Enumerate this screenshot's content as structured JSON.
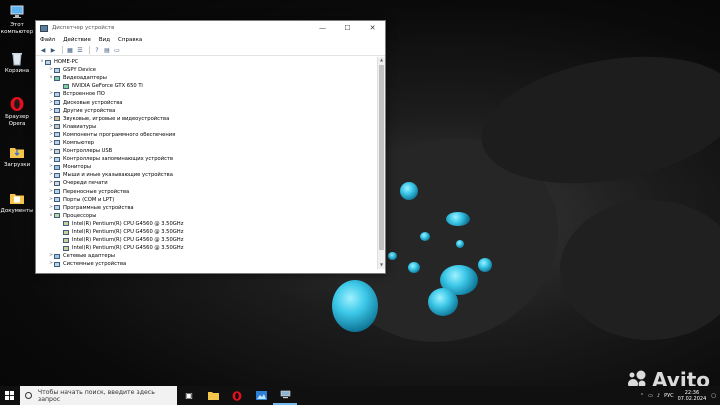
{
  "desktop": {
    "icons": [
      {
        "label": "Этот компьютер",
        "icon": "computer-icon"
      },
      {
        "label": "Корзина",
        "icon": "recycle-bin-icon"
      },
      {
        "label": "Браузер Opera",
        "icon": "opera-icon"
      },
      {
        "label": "Загрузки",
        "icon": "folder-icon"
      },
      {
        "label": "Документы",
        "icon": "folder-icon"
      }
    ]
  },
  "window": {
    "title": "Диспетчер устройств",
    "controls": {
      "minimize": "—",
      "maximize": "☐",
      "close": "✕"
    },
    "menu": [
      "Файл",
      "Действие",
      "Вид",
      "Справка"
    ],
    "toolbar": [
      "back-icon",
      "forward-icon",
      "grid-icon",
      "list-icon",
      "help-icon",
      "properties-icon",
      "monitor-icon"
    ],
    "tree": [
      {
        "depth": 0,
        "exp": "v",
        "label": "HOME-PC",
        "icon": "computer-icon"
      },
      {
        "depth": 1,
        "exp": ">",
        "label": "GSPY Device",
        "icon": "device-icon"
      },
      {
        "depth": 1,
        "exp": "v",
        "label": "Видеоадаптеры",
        "icon": "display-adapter-icon"
      },
      {
        "depth": 2,
        "exp": "",
        "label": "NVIDIA GeForce GTX 650 Ti",
        "icon": "display-adapter-icon"
      },
      {
        "depth": 1,
        "exp": ">",
        "label": "Встроенное ПО",
        "icon": "firmware-icon"
      },
      {
        "depth": 1,
        "exp": ">",
        "label": "Дисковые устройства",
        "icon": "disk-icon"
      },
      {
        "depth": 1,
        "exp": ">",
        "label": "Другие устройства",
        "icon": "other-devices-icon"
      },
      {
        "depth": 1,
        "exp": ">",
        "label": "Звуковые, игровые и видеоустройства",
        "icon": "sound-icon"
      },
      {
        "depth": 1,
        "exp": ">",
        "label": "Клавиатуры",
        "icon": "keyboard-icon"
      },
      {
        "depth": 1,
        "exp": ">",
        "label": "Компоненты программного обеспечения",
        "icon": "software-icon"
      },
      {
        "depth": 1,
        "exp": ">",
        "label": "Компьютер",
        "icon": "computer-icon"
      },
      {
        "depth": 1,
        "exp": ">",
        "label": "Контроллеры USB",
        "icon": "usb-icon"
      },
      {
        "depth": 1,
        "exp": ">",
        "label": "Контроллеры запоминающих устройств",
        "icon": "storage-icon"
      },
      {
        "depth": 1,
        "exp": ">",
        "label": "Мониторы",
        "icon": "monitor-icon"
      },
      {
        "depth": 1,
        "exp": ">",
        "label": "Мыши и иные указывающие устройства",
        "icon": "mouse-icon"
      },
      {
        "depth": 1,
        "exp": ">",
        "label": "Очереди печати",
        "icon": "printer-icon"
      },
      {
        "depth": 1,
        "exp": ">",
        "label": "Переносные устройства",
        "icon": "portable-icon"
      },
      {
        "depth": 1,
        "exp": ">",
        "label": "Порты (COM и LPT)",
        "icon": "port-icon"
      },
      {
        "depth": 1,
        "exp": ">",
        "label": "Программные устройства",
        "icon": "software-device-icon"
      },
      {
        "depth": 1,
        "exp": "v",
        "label": "Процессоры",
        "icon": "cpu-icon"
      },
      {
        "depth": 2,
        "exp": "",
        "label": "Intel(R) Pentium(R) CPU G4560 @ 3.50GHz",
        "icon": "cpu-icon"
      },
      {
        "depth": 2,
        "exp": "",
        "label": "Intel(R) Pentium(R) CPU G4560 @ 3.50GHz",
        "icon": "cpu-icon"
      },
      {
        "depth": 2,
        "exp": "",
        "label": "Intel(R) Pentium(R) CPU G4560 @ 3.50GHz",
        "icon": "cpu-icon"
      },
      {
        "depth": 2,
        "exp": "",
        "label": "Intel(R) Pentium(R) CPU G4560 @ 3.50GHz",
        "icon": "cpu-icon"
      },
      {
        "depth": 1,
        "exp": ">",
        "label": "Сетевые адаптеры",
        "icon": "network-icon"
      },
      {
        "depth": 1,
        "exp": ">",
        "label": "Системные устройства",
        "icon": "system-icon"
      }
    ]
  },
  "taskbar": {
    "search_placeholder": "Чтобы начать поиск, введите здесь запрос",
    "apps": [
      "task-view-icon",
      "file-explorer-icon",
      "opera-icon",
      "photos-icon",
      "device-manager-icon"
    ],
    "tray": {
      "language": "РУС",
      "time": "22:36",
      "date": "07.02.2024"
    }
  },
  "watermark": "Avito",
  "colors": {
    "accent": "#0078d7",
    "taskbar": "#101010",
    "drops": "#3cc8e8"
  }
}
